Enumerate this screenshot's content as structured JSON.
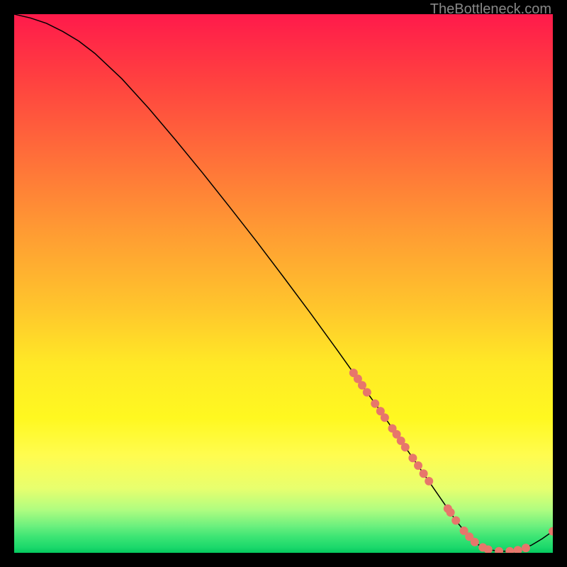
{
  "watermark": "TheBottleneck.com",
  "chart_data": {
    "type": "line",
    "title": "",
    "xlabel": "",
    "ylabel": "",
    "xlim": [
      0,
      100
    ],
    "ylim": [
      0,
      100
    ],
    "grid": false,
    "series": [
      {
        "name": "curve",
        "x": [
          0,
          3,
          6,
          9,
          12,
          15,
          20,
          25,
          30,
          35,
          40,
          45,
          50,
          55,
          60,
          63,
          65,
          68,
          70,
          72,
          74,
          76,
          78,
          80,
          82,
          84,
          86,
          88,
          90,
          92,
          94,
          96,
          98,
          100
        ],
        "y": [
          100,
          99.3,
          98.3,
          96.8,
          95,
          92.7,
          88,
          82.5,
          76.6,
          70.5,
          64.2,
          57.8,
          51.2,
          44.5,
          37.6,
          33.4,
          30.5,
          26.3,
          23.4,
          20.5,
          17.6,
          14.7,
          11.8,
          8.9,
          6.0,
          3.5,
          1.6,
          0.6,
          0.3,
          0.3,
          0.6,
          1.4,
          2.6,
          4.0
        ]
      }
    ],
    "markers": [
      {
        "x": 63.0,
        "y": 33.4
      },
      {
        "x": 63.8,
        "y": 32.3
      },
      {
        "x": 64.6,
        "y": 31.1
      },
      {
        "x": 65.5,
        "y": 29.8
      },
      {
        "x": 67.0,
        "y": 27.7
      },
      {
        "x": 68.0,
        "y": 26.3
      },
      {
        "x": 68.8,
        "y": 25.1
      },
      {
        "x": 70.2,
        "y": 23.1
      },
      {
        "x": 71.0,
        "y": 22.0
      },
      {
        "x": 71.8,
        "y": 20.8
      },
      {
        "x": 72.6,
        "y": 19.6
      },
      {
        "x": 74.0,
        "y": 17.6
      },
      {
        "x": 75.0,
        "y": 16.2
      },
      {
        "x": 76.0,
        "y": 14.7
      },
      {
        "x": 77.0,
        "y": 13.3
      },
      {
        "x": 80.5,
        "y": 8.2
      },
      {
        "x": 81.0,
        "y": 7.5
      },
      {
        "x": 82.0,
        "y": 6.0
      },
      {
        "x": 83.5,
        "y": 4.1
      },
      {
        "x": 84.5,
        "y": 3.0
      },
      {
        "x": 85.5,
        "y": 2.0
      },
      {
        "x": 87.0,
        "y": 1.0
      },
      {
        "x": 88.0,
        "y": 0.6
      },
      {
        "x": 90.0,
        "y": 0.3
      },
      {
        "x": 92.0,
        "y": 0.3
      },
      {
        "x": 93.5,
        "y": 0.5
      },
      {
        "x": 95.0,
        "y": 0.9
      },
      {
        "x": 100.0,
        "y": 4.0
      }
    ],
    "colors": {
      "line": "#000000",
      "marker": "#e7766b"
    }
  }
}
